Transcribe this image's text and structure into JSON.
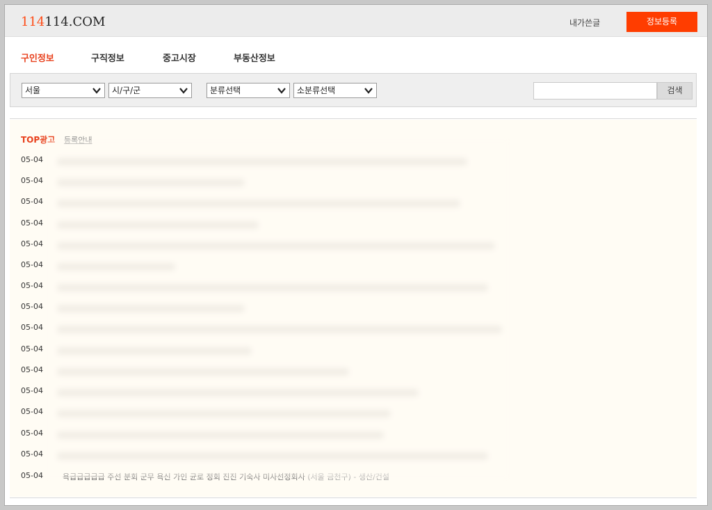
{
  "header": {
    "logo_red": "114",
    "logo_rest": "114.COM",
    "my_posts": "내가쓴글",
    "register_button": "정보등록"
  },
  "nav": {
    "items": [
      {
        "label": "구인정보",
        "active": true
      },
      {
        "label": "구직정보",
        "active": false
      },
      {
        "label": "중고시장",
        "active": false
      },
      {
        "label": "부동산정보",
        "active": false
      }
    ]
  },
  "filters": {
    "region": "서울",
    "district": "시/구/군",
    "category": "분류선택",
    "subcategory": "소분류선택",
    "search_value": "",
    "search_button": "검색"
  },
  "list": {
    "top_ad_label": "TOP광고",
    "register_info_link": "등록안내",
    "rows": [
      {
        "date": "05-04"
      },
      {
        "date": "05-04"
      },
      {
        "date": "05-04"
      },
      {
        "date": "05-04"
      },
      {
        "date": "05-04"
      },
      {
        "date": "05-04"
      },
      {
        "date": "05-04"
      },
      {
        "date": "05-04"
      },
      {
        "date": "05-04"
      },
      {
        "date": "05-04"
      },
      {
        "date": "05-04"
      },
      {
        "date": "05-04"
      },
      {
        "date": "05-04"
      },
      {
        "date": "05-04"
      },
      {
        "date": "05-04"
      },
      {
        "date": "05-04",
        "title": "욕급급급급급 주선 분회 군무 욕신 가인 균로 정회 진진 기숙사 미사선정회사",
        "meta": "(서울 금천구) - 생산/건설"
      }
    ]
  }
}
